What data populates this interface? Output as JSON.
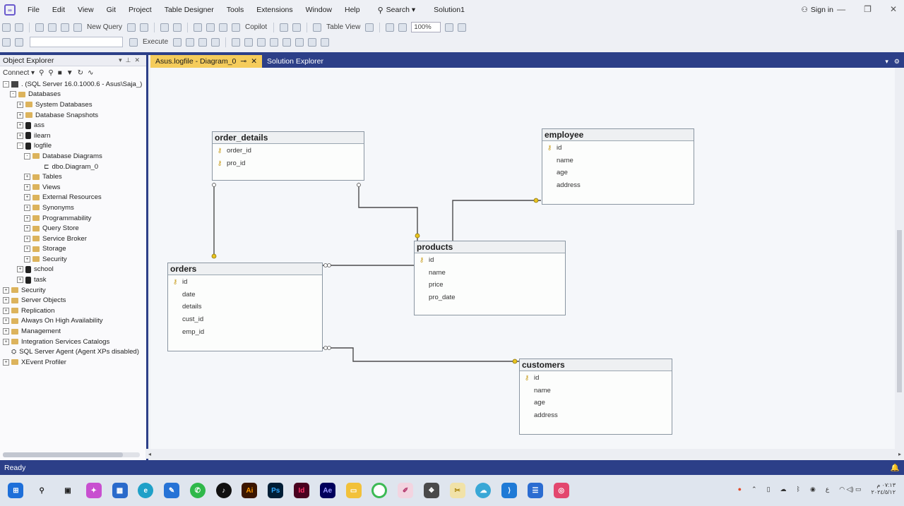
{
  "menubar": {
    "items": [
      "File",
      "Edit",
      "View",
      "Git",
      "Project",
      "Table Designer",
      "Tools",
      "Extensions",
      "Window",
      "Help"
    ],
    "search_label": "Search",
    "solution_name": "Solution1",
    "sign_in": "Sign in"
  },
  "toolbar": {
    "new_query": "New Query",
    "copilot": "Copilot",
    "table_view": "Table View",
    "zoom": "100%",
    "execute": "Execute"
  },
  "object_explorer": {
    "title": "Object Explorer",
    "connect": "Connect",
    "nodes": [
      {
        "label": ". (SQL Server 16.0.1000.6 - Asus\\Saja_)",
        "icon": "server-icon",
        "expander": "-"
      },
      {
        "label": "Databases",
        "icon": "folder-icon",
        "expander": "-"
      },
      {
        "label": "System Databases",
        "icon": "folder-icon",
        "expander": "+"
      },
      {
        "label": "Database Snapshots",
        "icon": "folder-icon",
        "expander": "+"
      },
      {
        "label": "ass",
        "icon": "database-icon",
        "expander": "+"
      },
      {
        "label": "ilearn",
        "icon": "database-icon",
        "expander": "+"
      },
      {
        "label": "logfile",
        "icon": "database-icon",
        "expander": "-"
      },
      {
        "label": "Database Diagrams",
        "icon": "folder-icon",
        "expander": "-"
      },
      {
        "label": "dbo.Diagram_0",
        "icon": "diagram-icon",
        "expander": ""
      },
      {
        "label": "Tables",
        "icon": "folder-icon",
        "expander": "+"
      },
      {
        "label": "Views",
        "icon": "folder-icon",
        "expander": "+"
      },
      {
        "label": "External Resources",
        "icon": "folder-icon",
        "expander": "+"
      },
      {
        "label": "Synonyms",
        "icon": "folder-icon",
        "expander": "+"
      },
      {
        "label": "Programmability",
        "icon": "folder-icon",
        "expander": "+"
      },
      {
        "label": "Query Store",
        "icon": "folder-icon",
        "expander": "+"
      },
      {
        "label": "Service Broker",
        "icon": "folder-icon",
        "expander": "+"
      },
      {
        "label": "Storage",
        "icon": "folder-icon",
        "expander": "+"
      },
      {
        "label": "Security",
        "icon": "folder-icon",
        "expander": "+"
      },
      {
        "label": "school",
        "icon": "database-icon",
        "expander": "+"
      },
      {
        "label": "task",
        "icon": "database-icon",
        "expander": "+"
      },
      {
        "label": "Security",
        "icon": "folder-icon",
        "expander": "+"
      },
      {
        "label": "Server Objects",
        "icon": "folder-icon",
        "expander": "+"
      },
      {
        "label": "Replication",
        "icon": "folder-icon",
        "expander": "+"
      },
      {
        "label": "Always On High Availability",
        "icon": "folder-icon",
        "expander": "+"
      },
      {
        "label": "Management",
        "icon": "folder-icon",
        "expander": "+"
      },
      {
        "label": "Integration Services Catalogs",
        "icon": "folder-icon",
        "expander": "+"
      },
      {
        "label": "SQL Server Agent (Agent XPs disabled)",
        "icon": "agent-icon",
        "expander": ""
      },
      {
        "label": "XEvent Profiler",
        "icon": "folder-icon",
        "expander": "+"
      }
    ]
  },
  "tabs": [
    {
      "label": "Asus.logfile - Diagram_0",
      "active": true
    },
    {
      "label": "Solution Explorer",
      "active": false
    }
  ],
  "diagram": {
    "tables": [
      {
        "name": "order_details",
        "columns": [
          {
            "name": "order_id",
            "key": true
          },
          {
            "name": "pro_id",
            "key": true
          }
        ]
      },
      {
        "name": "employee",
        "columns": [
          {
            "name": "id",
            "key": true
          },
          {
            "name": "name",
            "key": false
          },
          {
            "name": "age",
            "key": false
          },
          {
            "name": "address",
            "key": false
          }
        ]
      },
      {
        "name": "products",
        "columns": [
          {
            "name": "id",
            "key": true
          },
          {
            "name": "name",
            "key": false
          },
          {
            "name": "price",
            "key": false
          },
          {
            "name": "pro_date",
            "key": false
          }
        ]
      },
      {
        "name": "orders",
        "columns": [
          {
            "name": "id",
            "key": true
          },
          {
            "name": "date",
            "key": false
          },
          {
            "name": "details",
            "key": false
          },
          {
            "name": "cust_id",
            "key": false
          },
          {
            "name": "emp_id",
            "key": false
          }
        ]
      },
      {
        "name": "customers",
        "columns": [
          {
            "name": "id",
            "key": true
          },
          {
            "name": "name",
            "key": false
          },
          {
            "name": "age",
            "key": false
          },
          {
            "name": "address",
            "key": false
          }
        ]
      }
    ]
  },
  "statusbar": {
    "text": "Ready"
  },
  "taskbar": {
    "apps": [
      "start",
      "search",
      "task-view",
      "copilot",
      "store",
      "edge",
      "notes",
      "whatsapp",
      "tiktok",
      "illustrator",
      "photoshop",
      "indesign",
      "after-effects",
      "file-explorer",
      "green-app",
      "draw",
      "mixer",
      "paint",
      "chat",
      "vscode",
      "ssms",
      "instagram"
    ],
    "clock_time": "٠٧:١٣ م",
    "clock_date": "٢٠٢٤/٥/١٢"
  }
}
